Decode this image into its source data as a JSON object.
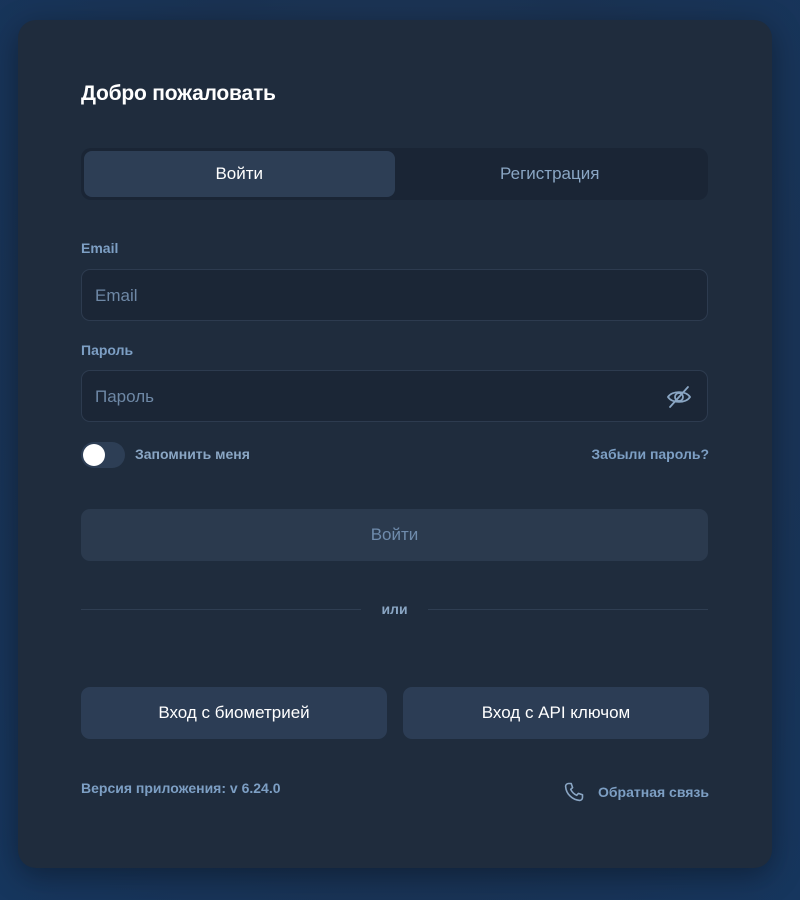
{
  "card": {
    "title": "Добро пожаловать",
    "tabs": [
      {
        "label": "Войти",
        "active": true
      },
      {
        "label": "Регистрация",
        "active": false
      }
    ],
    "email": {
      "label": "Email",
      "placeholder": "Email",
      "value": ""
    },
    "password": {
      "label": "Пароль",
      "placeholder": "Пароль",
      "value": "",
      "visibility_icon": "eye-off-icon"
    },
    "remember": {
      "label": "Запомнить меня",
      "checked": false
    },
    "forgot_label": "Забыли пароль?",
    "submit_label": "Войти",
    "divider_label": "или",
    "biometric_label": "Вход с биометрией",
    "api_key_label": "Вход с API ключом",
    "version_text": "Версия приложения: v 6.24.0",
    "feedback": {
      "label": "Обратная связь",
      "icon": "phone-icon"
    }
  },
  "colors": {
    "background": "#1a3252",
    "card": "#1f2c3d",
    "accent_text": "#7d9fc4",
    "button": "#2c3d55"
  }
}
